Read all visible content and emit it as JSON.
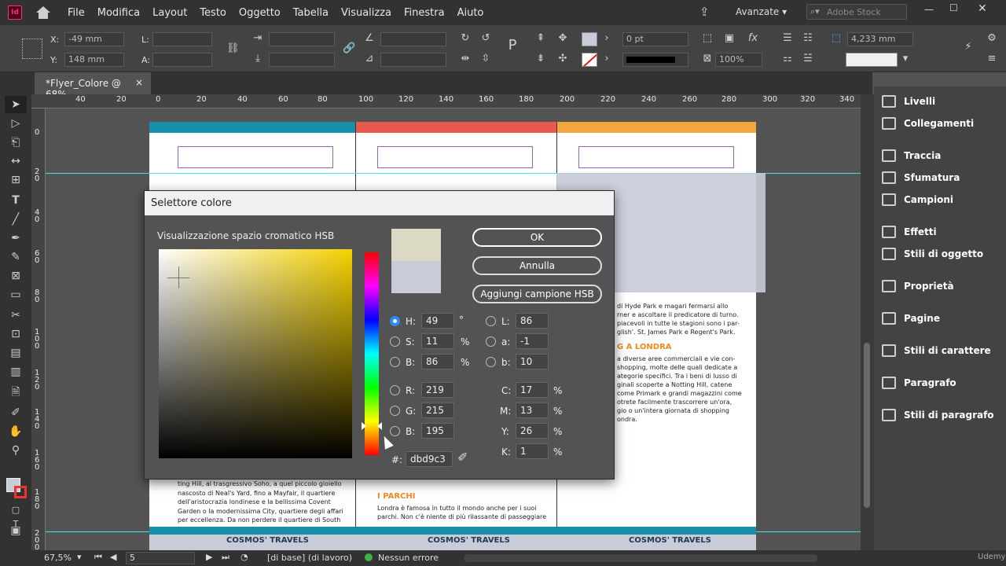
{
  "menu": {
    "items": [
      "File",
      "Modifica",
      "Layout",
      "Testo",
      "Oggetto",
      "Tabella",
      "Visualizza",
      "Finestra",
      "Aiuto"
    ],
    "app_icon": "Id",
    "workspace": "Avanzate",
    "search_placeholder": "Adobe Stock"
  },
  "control": {
    "x_label": "X:",
    "x_value": "-49 mm",
    "y_label": "Y:",
    "y_value": "148 mm",
    "l_label": "L:",
    "a_label": "A:",
    "stroke_weight": "0 pt",
    "zoom_percent": "100%",
    "dimension": "4,233 mm"
  },
  "tab": {
    "title": "*Flyer_Colore @ 68%",
    "close": "×"
  },
  "ruler": {
    "top": [
      "40",
      "20",
      "0",
      "20",
      "40",
      "60",
      "80",
      "100",
      "120",
      "140",
      "160",
      "180",
      "200",
      "220",
      "240",
      "260",
      "280",
      "300",
      "320",
      "340"
    ],
    "left": [
      "0",
      "2 0",
      "4 0",
      "6 0",
      "8 0",
      "1 0 0",
      "1 2 0",
      "1 4 0",
      "1 6 0",
      "1 8 0",
      "2 0 0"
    ]
  },
  "panels": [
    "Livelli",
    "Collegamenti",
    "Traccia",
    "Sfumatura",
    "Campioni",
    "Effetti",
    "Stili di oggetto",
    "Proprietà",
    "Pagine",
    "Stili di carattere",
    "Paragrafo",
    "Stili di paragrafo"
  ],
  "doc": {
    "col3_text": [
      "di Hyde Park e magari fermarsi allo",
      "rner e ascoltare il predicatore di turno.",
      "piacevoli in tutte le stagioni sono i par-",
      "glish'. St. James Park e Regent's Park."
    ],
    "col3_heading": "G A LONDRA",
    "col3_text2": [
      "a diverse aree commerciali e vie con-",
      "shopping, molte delle quali dedicate a",
      "ategorie specifici. Tra i beni di lusso di",
      "ginali scoperte a Notting Hill, catene",
      "come Primark e grandi magazzini come",
      "otrete facilmente trascorrere un'ora,",
      "gio o un'intera giornata di shopping",
      "ondra."
    ],
    "col1_text": [
      "ting Hill, al trasgressivo Soho, a quel piccolo gioiello",
      "nascosto di Neal's Yard, fino a Mayfair, il quartiere",
      "dell'aristocrazia londinese e la bellissima Covent",
      "Garden o la modernissima City, quartiere degli affari",
      "per eccellenza. Da non perdere il quartiere di South"
    ],
    "col2_heading": "I PARCHI",
    "col2_text": [
      "Londra è famosa in tutto il mondo anche per i suoi",
      "parchi. Non c'è niente di più rilassante di passeggiare"
    ],
    "footer": "COSMOS' TRAVELS"
  },
  "dialog": {
    "title": "Selettore colore",
    "space_label": "Visualizzazione spazio cromatico HSB",
    "ok": "OK",
    "cancel": "Annulla",
    "add_swatch": "Aggiungi campione HSB",
    "H": "49",
    "S": "11",
    "B": "86",
    "R": "219",
    "G": "215",
    "B2": "195",
    "L": "86",
    "a": "-1",
    "b": "10",
    "C": "17",
    "M": "13",
    "Y": "26",
    "K": "1",
    "hex": "dbd9c3",
    "labels": {
      "H": "H:",
      "S": "S:",
      "B": "B:",
      "R": "R:",
      "G": "G:",
      "B2": "B:",
      "L": "L:",
      "a": "a:",
      "b": "b:",
      "C": "C:",
      "M": "M:",
      "Y": "Y:",
      "K": "K:",
      "hex": "#:"
    },
    "units": {
      "deg": "°",
      "pct": "%"
    },
    "colors": {
      "new": "#dbd9c3",
      "old": "#c8ccd8",
      "hue_base": "#f5d200"
    }
  },
  "status": {
    "zoom": "67,5%",
    "page": "5",
    "master": "[di base] (di lavoro)",
    "errors": "Nessun errore",
    "watermark": "Udemy"
  }
}
